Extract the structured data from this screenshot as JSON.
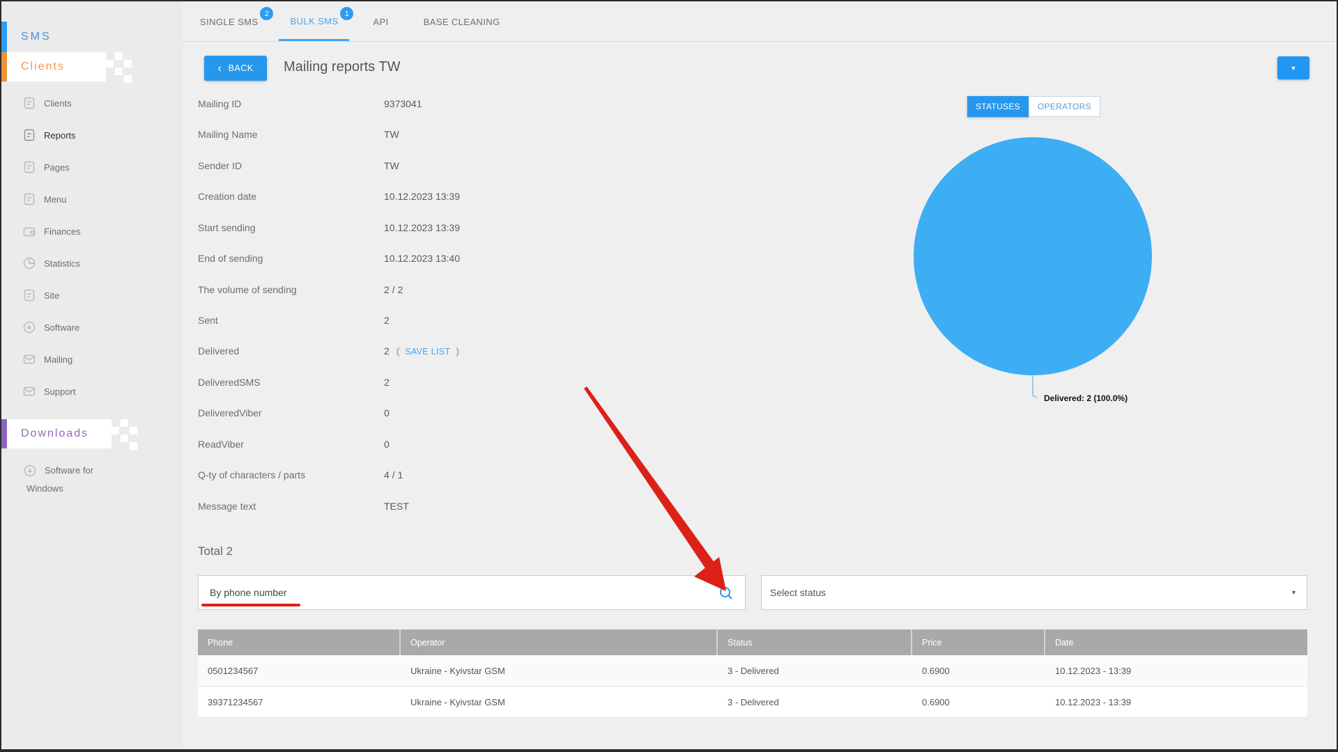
{
  "sidebar": {
    "sms_label": "SMS",
    "clients_label": "Clients",
    "downloads_label": "Downloads",
    "items": [
      {
        "label": "Clients"
      },
      {
        "label": "Reports"
      },
      {
        "label": "Pages"
      },
      {
        "label": "Menu"
      },
      {
        "label": "Finances"
      },
      {
        "label": "Statistics"
      },
      {
        "label": "Site"
      },
      {
        "label": "Software"
      },
      {
        "label": "Mailing"
      },
      {
        "label": "Support"
      }
    ],
    "software_for_windows_line1": "Software for",
    "software_for_windows_line2": "Windows"
  },
  "tabs": [
    {
      "label": "SINGLE SMS",
      "badge": "2"
    },
    {
      "label": "BULK SMS",
      "badge": "1"
    },
    {
      "label": "API"
    },
    {
      "label": "BASE CLEANING"
    }
  ],
  "header": {
    "back_chevron": "‹",
    "back_label": "BACK",
    "title": "Mailing reports TW",
    "dropdown_caret": "▼"
  },
  "details": {
    "rows": [
      {
        "label": "Mailing ID",
        "value": "9373041"
      },
      {
        "label": "Mailing Name",
        "value": "TW"
      },
      {
        "label": "Sender ID",
        "value": "TW"
      },
      {
        "label": "Creation date",
        "value": "10.12.2023 13:39"
      },
      {
        "label": "Start sending",
        "value": "10.12.2023 13:39"
      },
      {
        "label": "End of sending",
        "value": "10.12.2023 13:40"
      },
      {
        "label": "The volume of sending",
        "value": "2 / 2"
      },
      {
        "label": "Sent",
        "value": "2"
      },
      {
        "label": "Delivered",
        "value": "2"
      },
      {
        "label": "DeliveredSMS",
        "value": "2"
      },
      {
        "label": "DeliveredViber",
        "value": "0"
      },
      {
        "label": "ReadViber",
        "value": "0"
      },
      {
        "label": "Q-ty of characters / parts",
        "value": "4 / 1"
      },
      {
        "label": "Message text",
        "value": "TEST"
      }
    ],
    "save_open": "(",
    "save_list_label": "SAVE LIST",
    "save_close": ")"
  },
  "chart": {
    "toggle_statuses": "STATUSES",
    "toggle_operators": "OPERATORS",
    "slice_label": "Delivered: 2 (100.0%)",
    "pie_color": "#3daef3"
  },
  "chart_data": {
    "type": "pie",
    "title": "STATUSES",
    "slices": [
      {
        "label": "Delivered",
        "value": 2,
        "percent": 100.0,
        "color": "#3daef3"
      }
    ],
    "legend_position": "bottom"
  },
  "results": {
    "total_label": "Total 2",
    "search_value": "By phone number",
    "select_value": "Select status",
    "select_caret": "▾",
    "table": {
      "columns": [
        "Phone",
        "Operator",
        "Status",
        "Price",
        "Date"
      ],
      "rows": [
        [
          "0501234567",
          "Ukraine - Kyivstar GSM",
          "3 - Delivered",
          "0.6900",
          "10.12.2023 - 13:39"
        ],
        [
          "39371234567",
          "Ukraine - Kyivstar GSM",
          "3 - Delivered",
          "0.6900",
          "10.12.2023 - 13:39"
        ]
      ]
    }
  }
}
